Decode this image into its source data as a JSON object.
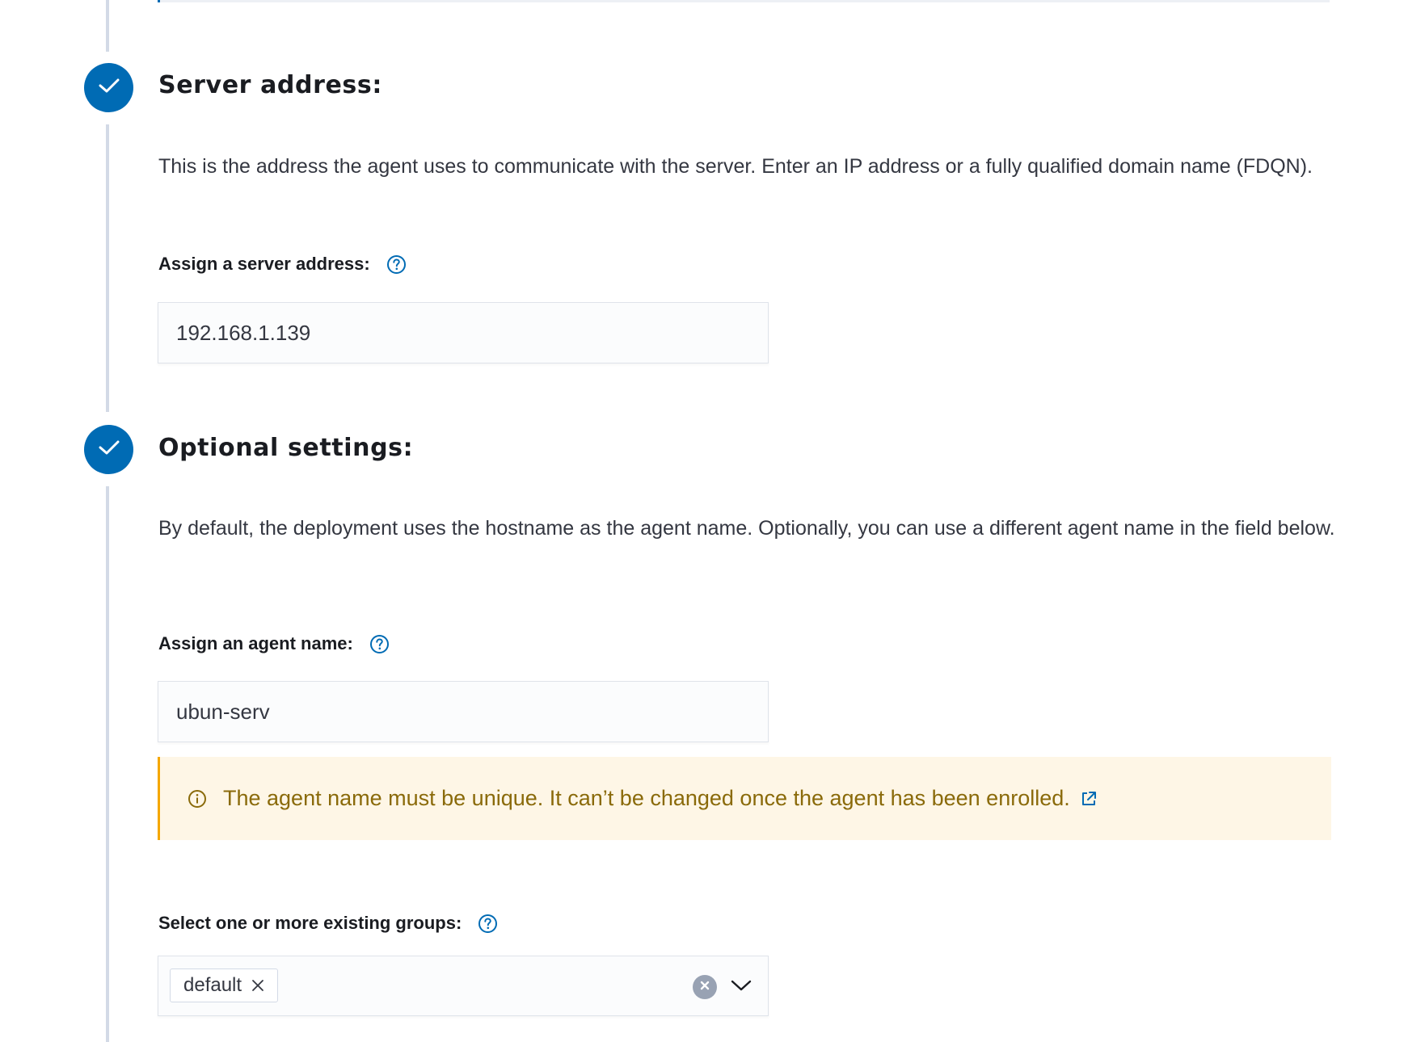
{
  "steps": [
    {
      "title": "Server address:",
      "description": "This is the address the agent uses to communicate with the server. Enter an IP address or a fully qualified domain name (FDQN).",
      "field_label": "Assign a server address:",
      "field_value": "192.168.1.139"
    },
    {
      "title": "Optional settings:",
      "description": "By default, the deployment uses the hostname as the agent name. Optionally, you can use a different agent name in the field below.",
      "field_label": "Assign an agent name:",
      "field_value": "ubun-serv",
      "callout": "The agent name must be unique. It can’t be changed once the agent has been enrolled.",
      "groups_label": "Select one or more existing groups:",
      "selected_groups": [
        "default"
      ]
    }
  ],
  "icons": {
    "step_complete": "check-icon",
    "help": "question-circle-icon",
    "callout": "info-icon",
    "external_link": "external-link-icon",
    "pill_remove": "cross-icon",
    "clear": "clear-circle-icon",
    "dropdown": "chevron-down-icon"
  },
  "colors": {
    "primary": "#006bb4",
    "warning_bg": "#fef6e6",
    "warning_border": "#f5a700",
    "warning_text": "#8a6a0a",
    "connector": "#d3dae6"
  }
}
